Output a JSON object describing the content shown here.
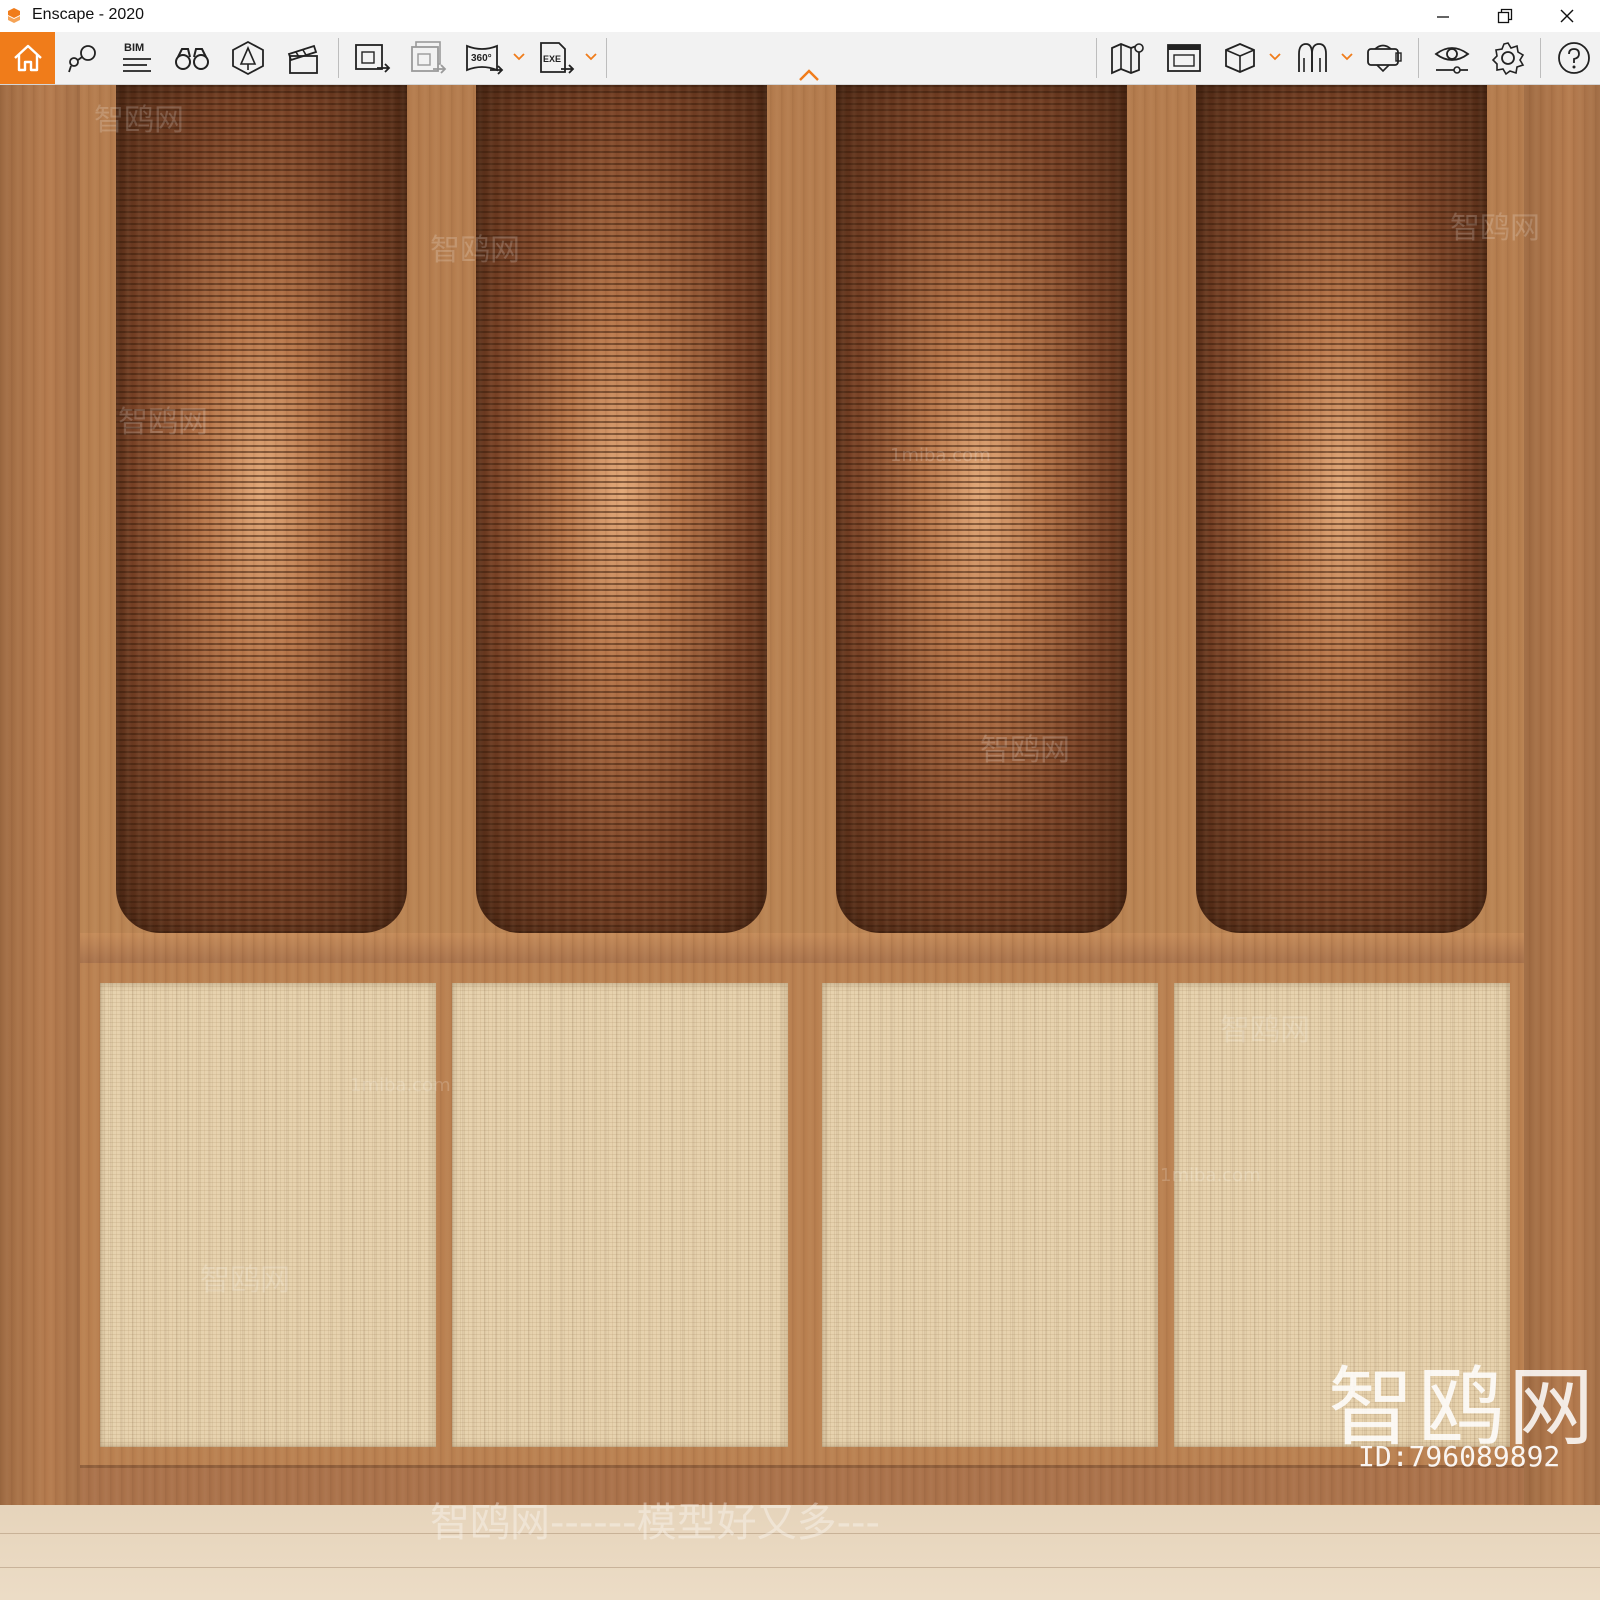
{
  "window": {
    "title": "Enscape - 2020",
    "controls": {
      "minimize": "minimize-icon",
      "restore": "restore-icon",
      "close": "close-icon"
    }
  },
  "toolbar": {
    "accent_color": "#f07c1a",
    "bim_label": "BIM",
    "left_tools": [
      "home-icon",
      "views-icon",
      "bim-icon",
      "binoculars-icon",
      "light-view-icon",
      "clapper-icon"
    ],
    "export_tools": [
      "screenshot-icon",
      "batch-render-icon",
      "panorama-360-icon",
      "exe-export-icon"
    ],
    "right_tools": [
      "map-icon",
      "asset-library-icon",
      "cube-icon",
      "ghost-icon",
      "vr-headset-icon",
      "visual-settings-icon",
      "settings-gear-icon",
      "help-icon"
    ],
    "panorama_label": "360°",
    "exe_label": "EXE"
  },
  "scene": {
    "watermark_brand": "智鸥网",
    "watermark_id": "ID:796089892",
    "watermark_slogan": "智鸥网------模型好又多---",
    "watermark_faint": [
      "智鸥网",
      "1miba.com"
    ]
  }
}
